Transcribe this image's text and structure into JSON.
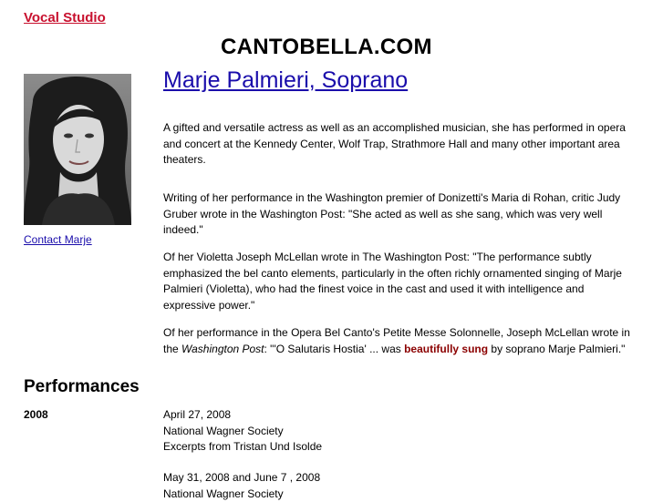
{
  "nav": {
    "studio_link": "Vocal Studio"
  },
  "site_title": "CANTOBELLA.COM",
  "sidebar": {
    "contact_link": "Contact Marje"
  },
  "bio": {
    "heading": "Marje Palmieri, Soprano",
    "p1": "A gifted and versatile actress as well as an accomplished musician, she has performed in opera and concert at the Kennedy Center, Wolf Trap, Strathmore Hall and many other important area theaters.",
    "p2": "Writing of her performance in the Washington premier of Donizetti's Maria di Rohan, critic Judy Gruber wrote in the Washington Post: \"She acted as well as she sang, which was very well indeed.\"",
    "p3": "Of her Violetta Joseph McLellan wrote in The Washington Post: \"The performance subtly emphasized the bel canto elements, particularly in the often richly ornamented singing of Marje Palmieri (Violetta), who had the finest voice in the cast and used it with intelligence and expressive power.\"",
    "p4_a": "Of her performance in the Opera Bel Canto's Petite Messe Solonnelle, Joseph McLellan wrote in the ",
    "p4_italic": "Washington Post",
    "p4_b": ": \"'O Salutaris Hostia' ... was ",
    "p4_highlight": "beautifully sung",
    "p4_c": " by soprano Marje Palmieri.\""
  },
  "performances": {
    "heading": "Performances",
    "year": "2008",
    "events": [
      {
        "date": "April 27, 2008",
        "org": "National Wagner Society",
        "program": "Excerpts from Tristan Und Isolde"
      },
      {
        "date": "May 31, 2008 and June 7 , 2008",
        "org": "National Wagner Society"
      }
    ]
  },
  "colors": {
    "nav_link": "#c8102e",
    "link": "#1a0dab",
    "highlight": "#8b0000"
  }
}
